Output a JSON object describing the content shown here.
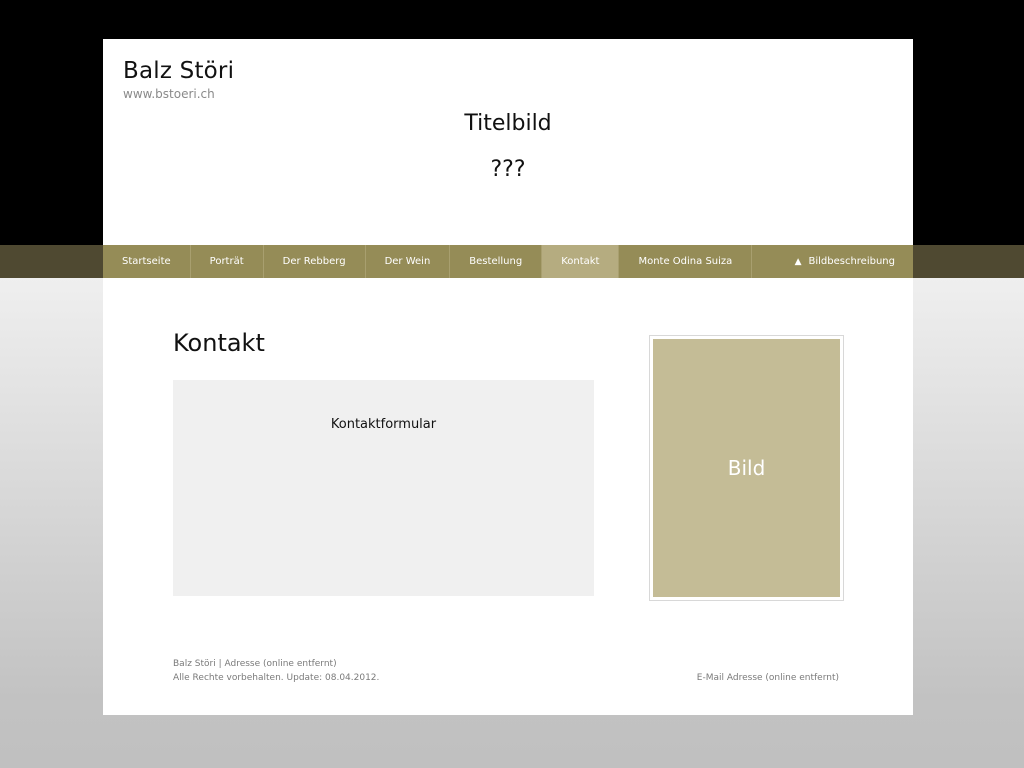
{
  "header": {
    "site_title": "Balz Störi",
    "site_url": "www.bstoeri.ch",
    "title_image": "Titelbild",
    "title_sub": "???"
  },
  "nav": {
    "items": [
      {
        "label": "Startseite",
        "active": false
      },
      {
        "label": "Porträt",
        "active": false
      },
      {
        "label": "Der Rebberg",
        "active": false
      },
      {
        "label": "Der Wein",
        "active": false
      },
      {
        "label": "Bestellung",
        "active": false
      },
      {
        "label": "Kontakt",
        "active": true
      },
      {
        "label": "Monte Odina Suiza",
        "active": false
      }
    ],
    "image_description": "Bildbeschreibung",
    "image_description_icon": "triangle-up-icon"
  },
  "main": {
    "heading": "Kontakt",
    "form_label": "Kontaktformular",
    "image_label": "Bild"
  },
  "footer": {
    "line1": "Balz Störi | Adresse (online entfernt)",
    "line2": "Alle Rechte vorbehalten. Update: 08.04.2012.",
    "email": "E-Mail Adresse (online entfernt)"
  },
  "colors": {
    "nav": "#958c57",
    "nav_active": "#b5ac80",
    "image_placeholder": "#c4bc96"
  }
}
